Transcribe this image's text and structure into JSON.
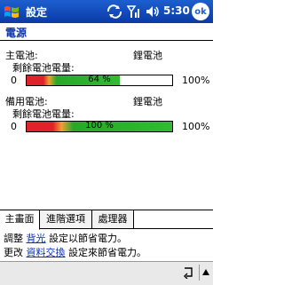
{
  "titlebar": {
    "title": "設定",
    "time": "5:30",
    "ok_label": "ok"
  },
  "page": {
    "title": "電源"
  },
  "main_battery": {
    "label": "主電池:",
    "type": "鋰電池",
    "remaining_label": "剩餘電池電量:",
    "min_label": "0",
    "max_label": "100%",
    "percent": 64,
    "percent_text": "64 %"
  },
  "backup_battery": {
    "label": "備用電池:",
    "type": "鋰電池",
    "remaining_label": "剩餘電池電量:",
    "min_label": "0",
    "max_label": "100%",
    "percent": 100,
    "percent_text": "100 %"
  },
  "tabs": [
    {
      "label": "主畫面",
      "active": true
    },
    {
      "label": "進階選項",
      "active": false
    },
    {
      "label": "處理器",
      "active": false
    }
  ],
  "description": {
    "line1_prefix": "調整 ",
    "line1_link": "背光",
    "line1_suffix": " 設定以節省電力。",
    "line2_prefix": "更改 ",
    "line2_link": "資料交換",
    "line2_suffix": " 設定來節省電力。"
  },
  "icons": {
    "start": "windows-flag-icon",
    "sync": "activesync-icon",
    "signal": "signal-icon",
    "volume": "speaker-icon",
    "undo": "undo-arrow-icon",
    "sip": "up-arrow-icon"
  },
  "colors": {
    "titlebar": "#1d5fd0",
    "page_title": "#1036a8",
    "battery_green": "#2aa72a",
    "battery_red": "#e0222a",
    "link": "#0a2ec7"
  }
}
